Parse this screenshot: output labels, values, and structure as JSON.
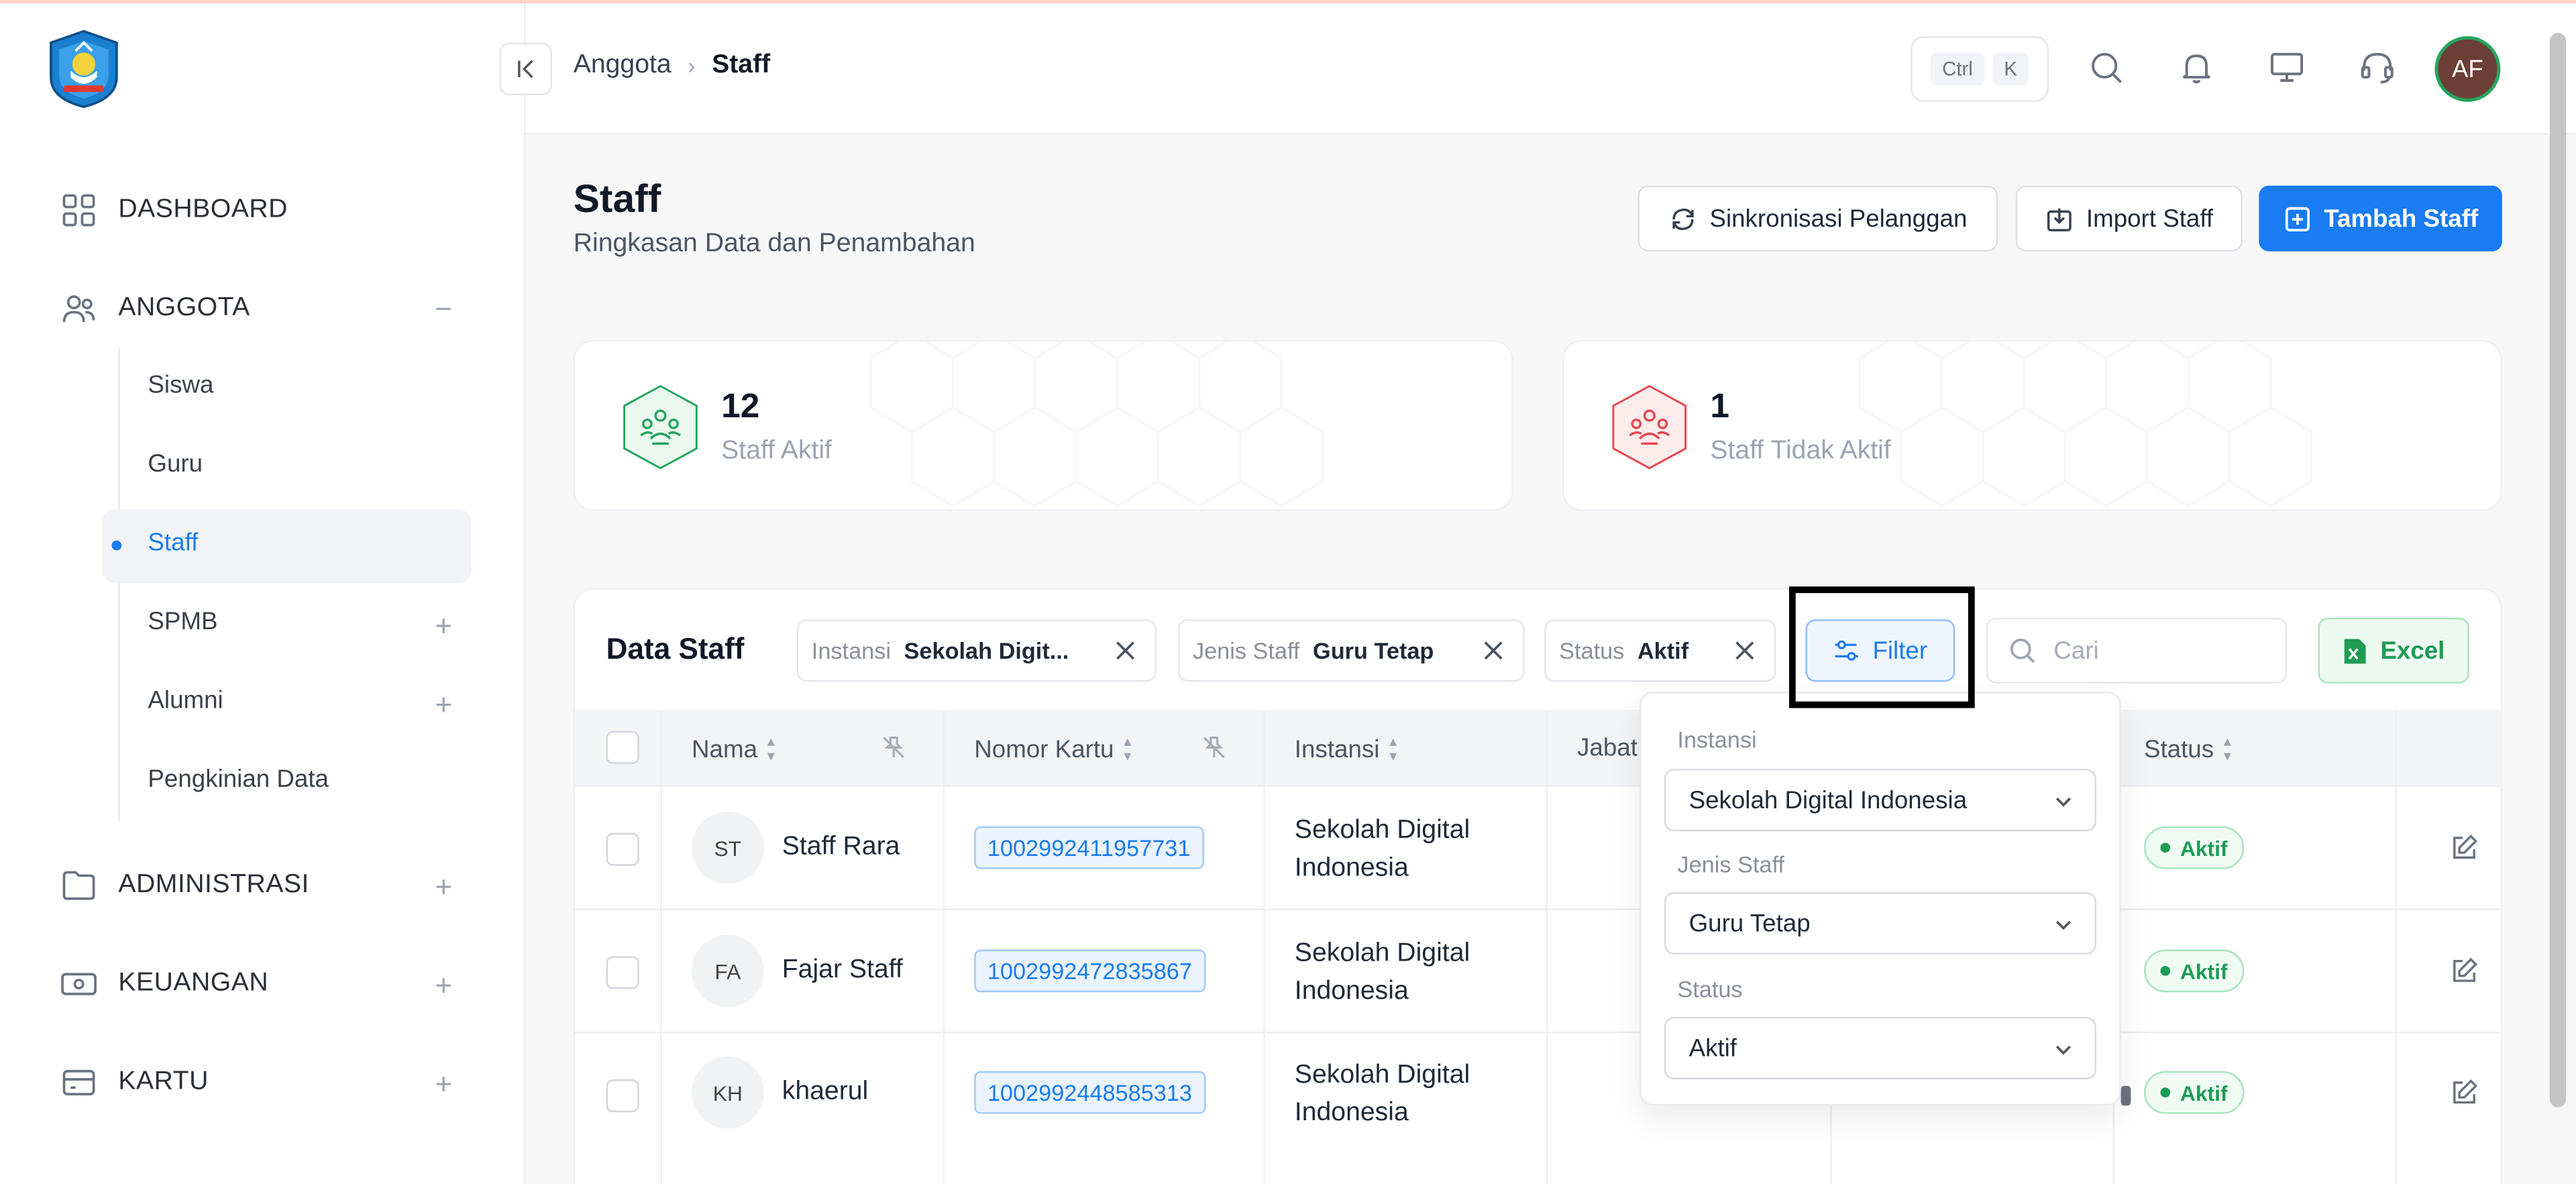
{
  "header": {
    "breadcrumb": {
      "parent": "Anggota",
      "current": "Staff"
    },
    "shortcut": {
      "key1": "Ctrl",
      "key2": "K"
    },
    "avatar_initials": "AF"
  },
  "sidebar": {
    "dashboard": "DASHBOARD",
    "anggota": "ANGGOTA",
    "anggota_sub": [
      "Siswa",
      "Guru",
      "Staff",
      "SPMB",
      "Alumni",
      "Pengkinian Data"
    ],
    "administrasi": "ADMINISTRASI",
    "keuangan": "KEUANGAN",
    "kartu": "KARTU"
  },
  "page": {
    "title": "Staff",
    "subtitle": "Ringkasan Data dan Penambahan",
    "buttons": {
      "sync": "Sinkronisasi Pelanggan",
      "import": "Import Staff",
      "add": "Tambah Staff"
    }
  },
  "stats": [
    {
      "value": "12",
      "label": "Staff Aktif",
      "color": "#25a55f"
    },
    {
      "value": "1",
      "label": "Staff Tidak Aktif",
      "color": "#e5484d"
    }
  ],
  "table_panel": {
    "title": "Data Staff",
    "chips": [
      {
        "key": "Instansi",
        "value": "Sekolah Digit..."
      },
      {
        "key": "Jenis Staff",
        "value": "Guru Tetap"
      },
      {
        "key": "Status",
        "value": "Aktif"
      }
    ],
    "filter_label": "Filter",
    "search_placeholder": "Cari",
    "excel_label": "Excel",
    "columns": [
      "Nama",
      "Nomor Kartu",
      "Instansi",
      "Jabat",
      "Status"
    ],
    "rows": [
      {
        "initials": "ST",
        "name": "Staff Rara",
        "card": "1002992411957731",
        "inst1": "Sekolah Digital",
        "inst2": "Indonesia",
        "status": "Aktif"
      },
      {
        "initials": "FA",
        "name": "Fajar Staff",
        "card": "1002992472835867",
        "inst1": "Sekolah Digital",
        "inst2": "Indonesia",
        "status": "Aktif"
      },
      {
        "initials": "KH",
        "name": "khaerul",
        "card": "1002992448585313",
        "inst1": "Sekolah Digital",
        "inst2": "Indonesia",
        "status": "Aktif"
      }
    ]
  },
  "filter_dropdown": {
    "instansi_label": "Instansi",
    "instansi_value": "Sekolah Digital Indonesia",
    "jenis_label": "Jenis Staff",
    "jenis_value": "Guru Tetap",
    "status_label": "Status",
    "status_value": "Aktif"
  },
  "colors": {
    "primary": "#1a7cf2",
    "success": "#1e9b55",
    "danger": "#e5484d"
  }
}
